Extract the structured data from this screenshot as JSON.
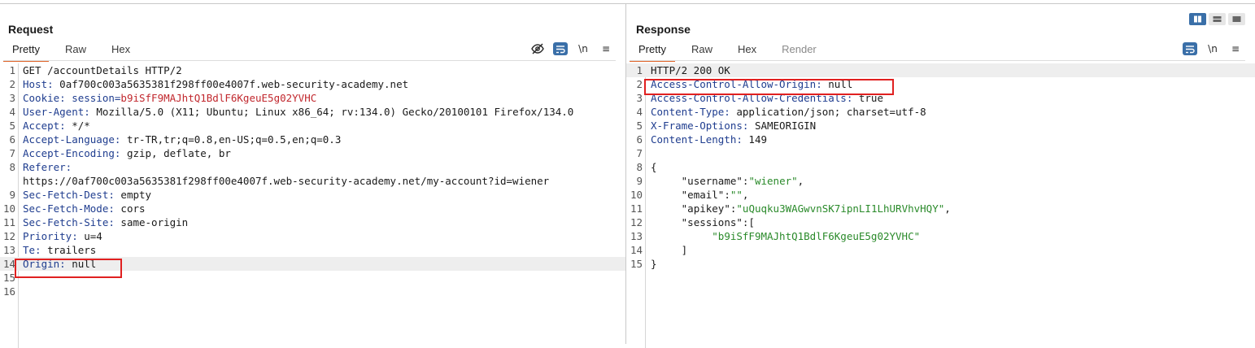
{
  "request": {
    "title": "Request",
    "tabs": [
      {
        "label": "Pretty",
        "active": true
      },
      {
        "label": "Raw"
      },
      {
        "label": "Hex"
      }
    ],
    "tools": {
      "newline_label": "\\n",
      "menu_label": "≡"
    },
    "lines": [
      {
        "n": "1",
        "text": "GET /accountDetails HTTP/2"
      },
      {
        "n": "2",
        "key": "Host:",
        "val": " 0af700c003a5635381f298ff00e4007f.web-security-academy.net"
      },
      {
        "n": "3",
        "key": "Cookie:",
        "ckey": " session=",
        "cval": "b9iSfF9MAJhtQ1BdlF6KgeuE5g02YVHC"
      },
      {
        "n": "4",
        "key": "User-Agent:",
        "val": " Mozilla/5.0 (X11; Ubuntu; Linux x86_64; rv:134.0) Gecko/20100101 Firefox/134.0"
      },
      {
        "n": "5",
        "key": "Accept:",
        "val": " */*"
      },
      {
        "n": "6",
        "key": "Accept-Language:",
        "val": " tr-TR,tr;q=0.8,en-US;q=0.5,en;q=0.3"
      },
      {
        "n": "7",
        "key": "Accept-Encoding:",
        "val": " gzip, deflate, br"
      },
      {
        "n": "8",
        "key": "Referer:",
        "val": ""
      },
      {
        "n": "",
        "val": "https://0af700c003a5635381f298ff00e4007f.web-security-academy.net/my-account?id=wiener"
      },
      {
        "n": "9",
        "key": "Sec-Fetch-Dest:",
        "val": " empty"
      },
      {
        "n": "10",
        "key": "Sec-Fetch-Mode:",
        "val": " cors"
      },
      {
        "n": "11",
        "key": "Sec-Fetch-Site:",
        "val": " same-origin"
      },
      {
        "n": "12",
        "key": "Priority:",
        "val": " u=4"
      },
      {
        "n": "13",
        "key": "Te:",
        "val": " trailers"
      },
      {
        "n": "14",
        "key": "Origin:",
        "val": " null"
      },
      {
        "n": "15",
        "val": ""
      },
      {
        "n": "16",
        "val": ""
      }
    ]
  },
  "response": {
    "title": "Response",
    "tabs": [
      {
        "label": "Pretty",
        "active": true
      },
      {
        "label": "Raw"
      },
      {
        "label": "Hex"
      },
      {
        "label": "Render",
        "disabled": true
      }
    ],
    "tools": {
      "newline_label": "\\n",
      "menu_label": "≡"
    },
    "lines": [
      {
        "n": "1",
        "text": "HTTP/2 200 OK"
      },
      {
        "n": "2",
        "key": "Access-Control-Allow-Origin:",
        "val": " null"
      },
      {
        "n": "3",
        "key": "Access-Control-Allow-Credentials:",
        "val": " true"
      },
      {
        "n": "4",
        "key": "Content-Type:",
        "val": " application/json; charset=utf-8"
      },
      {
        "n": "5",
        "key": "X-Frame-Options:",
        "val": " SAMEORIGIN"
      },
      {
        "n": "6",
        "key": "Content-Length:",
        "val": " 149"
      },
      {
        "n": "7",
        "val": ""
      },
      {
        "n": "8",
        "val": "{"
      },
      {
        "n": "9",
        "indent": "     ",
        "jkey": "\"username\"",
        "sep": ":",
        "jval": "\"wiener\"",
        "tail": ","
      },
      {
        "n": "10",
        "indent": "     ",
        "jkey": "\"email\"",
        "sep": ":",
        "jval": "\"\"",
        "tail": ","
      },
      {
        "n": "11",
        "indent": "     ",
        "jkey": "\"apikey\"",
        "sep": ":",
        "jval": "\"uQuqku3WAGwvnSK7ipnLI1LhURVhvHQY\"",
        "tail": ","
      },
      {
        "n": "12",
        "indent": "     ",
        "jkey": "\"sessions\"",
        "sep": ":[",
        "jval": "",
        "tail": ""
      },
      {
        "n": "13",
        "indent": "          ",
        "jval": "\"b9iSfF9MAJhtQ1BdlF6KgeuE5g02YVHC\""
      },
      {
        "n": "14",
        "val": "     ]"
      },
      {
        "n": "15",
        "val": "}"
      }
    ]
  },
  "layout_buttons": [
    "split-vertical",
    "split-horizontal",
    "single"
  ]
}
